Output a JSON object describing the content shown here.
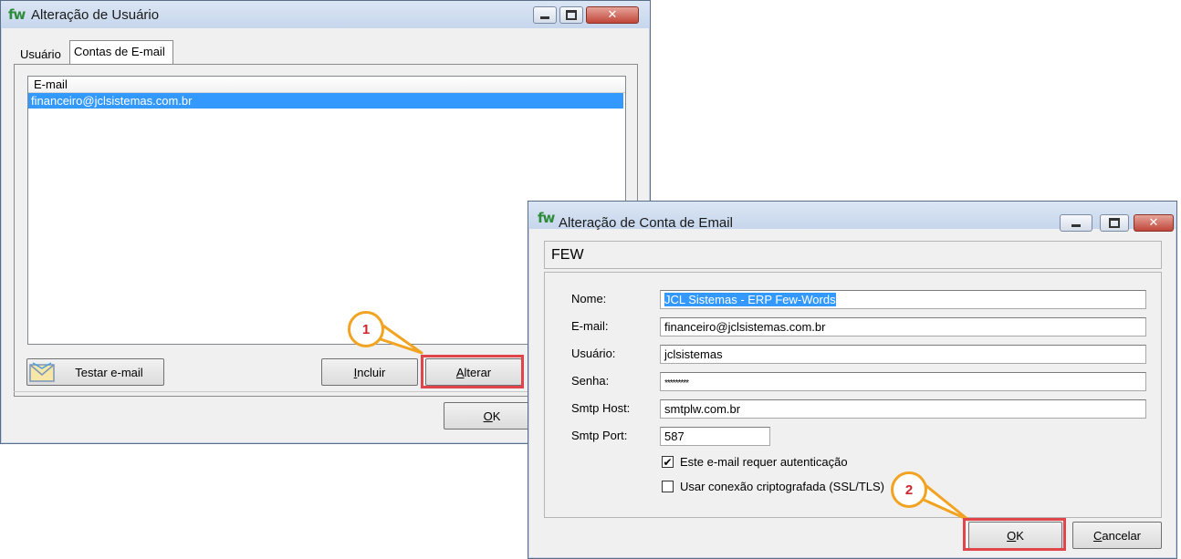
{
  "user_window": {
    "logo": "fw",
    "title": "Alteração de Usuário",
    "tabs": [
      {
        "label": "Usuário",
        "active": false
      },
      {
        "label": "Contas de E-mail",
        "active": true
      }
    ],
    "email_list": {
      "column_header": "E-mail",
      "rows": [
        "financeiro@jclsistemas.com.br"
      ],
      "selected_index": 0
    },
    "buttons": {
      "test_email": "Testar e-mail",
      "include": "ncluir",
      "include_mnemonic": "I",
      "change": "lterar",
      "change_mnemonic": "A",
      "ok": "K",
      "ok_mnemonic": "O"
    }
  },
  "email_window": {
    "logo": "fw",
    "title": "Alteração de Conta de Email",
    "header_panel": "FEW",
    "fields": {
      "name_label": "Nome:",
      "name_value": "JCL Sistemas - ERP Few-Words",
      "email_label": "E-mail:",
      "email_value": "financeiro@jclsistemas.com.br",
      "user_label": "Usuário:",
      "user_value": "jclsistemas",
      "password_label": "Senha:",
      "password_value": "*********",
      "smtp_host_label": "Smtp Host:",
      "smtp_host_value": "smtplw.com.br",
      "smtp_port_label": "Smtp Port:",
      "smtp_port_value": "587"
    },
    "checkboxes": {
      "auth_label": "Este e-mail requer autenticação",
      "auth_checked": true,
      "ssl_label": "Usar conexão criptografada (SSL/TLS)",
      "ssl_checked": false
    },
    "buttons": {
      "ok": "K",
      "ok_mnemonic": "O",
      "cancel": "ancelar",
      "cancel_mnemonic": "C"
    }
  },
  "annotations": {
    "step1": "1",
    "step2": "2",
    "accent_color": "#e0454c",
    "callout_color": "#f2a322"
  }
}
